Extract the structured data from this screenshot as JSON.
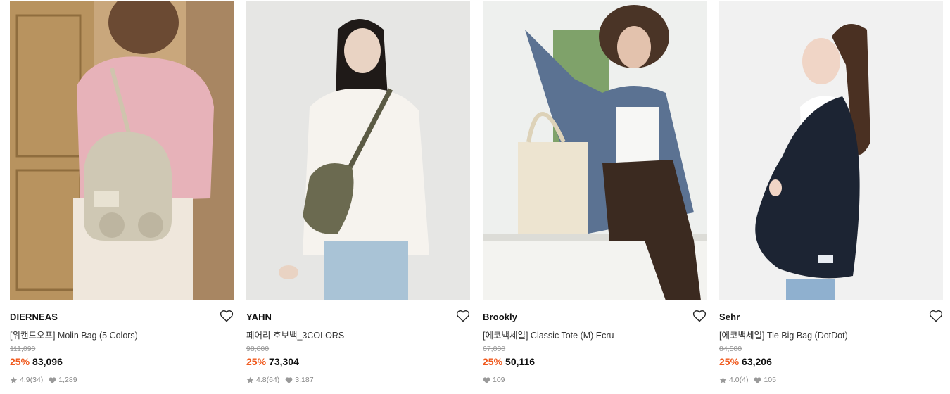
{
  "products": [
    {
      "brand": "DIERNEAS",
      "name": "[위캔드오프] Molin Bag (5 Colors)",
      "original_price": "111,090",
      "discount": "25%",
      "price": "83,096",
      "rating": "4.9",
      "reviews": "(34)",
      "likes": "1,289",
      "icons": {
        "like": "heart-outline-icon",
        "star": "star-icon",
        "likes": "heart-filled-icon"
      }
    },
    {
      "brand": "YAHN",
      "name": "페어리 호보백_3COLORS",
      "original_price": "98,000",
      "discount": "25%",
      "price": "73,304",
      "rating": "4.8",
      "reviews": "(64)",
      "likes": "3,187",
      "icons": {
        "like": "heart-outline-icon",
        "star": "star-icon",
        "likes": "heart-filled-icon"
      }
    },
    {
      "brand": "Brookly",
      "name": "[에코백세일] Classic Tote (M) Ecru",
      "original_price": "67,000",
      "discount": "25%",
      "price": "50,116",
      "likes": "109",
      "icons": {
        "like": "heart-outline-icon",
        "likes": "heart-filled-icon"
      }
    },
    {
      "brand": "Sehr",
      "name": "[에코백세일] Tie Big Bag (DotDot)",
      "original_price": "84,500",
      "discount": "25%",
      "price": "63,206",
      "rating": "4.0",
      "reviews": "(4)",
      "likes": "105",
      "icons": {
        "like": "heart-outline-icon",
        "star": "star-icon",
        "likes": "heart-filled-icon"
      }
    }
  ],
  "colors": {
    "discount": "#f05a1e",
    "text": "#111111",
    "muted": "#999999",
    "meta": "#888888"
  }
}
